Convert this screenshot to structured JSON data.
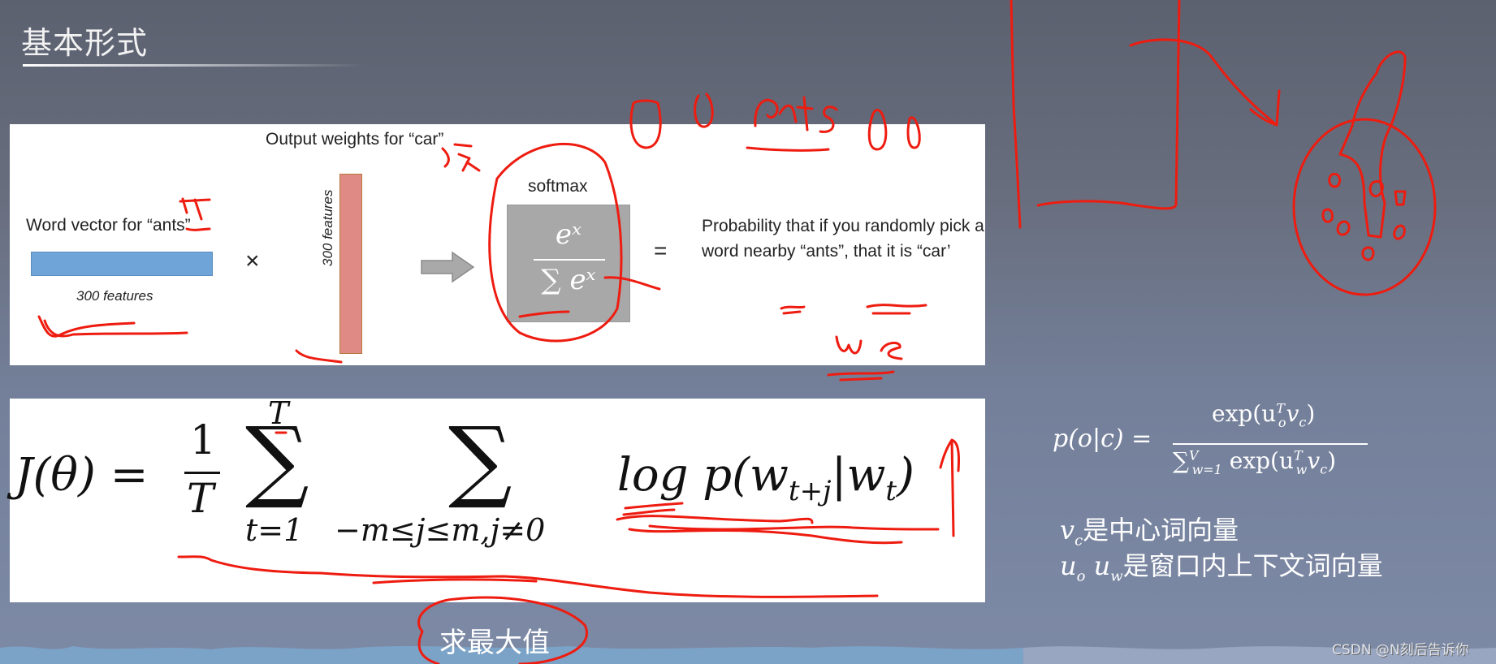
{
  "slide": {
    "title": "基本形式",
    "diagram": {
      "word_vector_label": "Word vector for “ants”",
      "word_vector_features": "300 features",
      "multiply_symbol": "×",
      "output_weights_label": "Output weights for “car”",
      "output_weights_features": "300 features",
      "softmax_label": "softmax",
      "softmax_numerator": "eˣ",
      "softmax_denominator": "∑ eˣ",
      "equals_symbol": "=",
      "probability_text": "Probability that if you randomly pick a word nearby “ants”, that it is “car’"
    },
    "objective": {
      "lhs": "J(θ) =",
      "frac_num": "1",
      "frac_den": "T",
      "sum1_upper": "T",
      "sum1_lower": "t=1",
      "sum2_lower": "−m≤j≤m,j≠0",
      "term": "log p(w",
      "term_sub": "t+j",
      "term_mid": "|w",
      "term_sub2": "t",
      "term_end": ")"
    },
    "softmax_formula": {
      "lhs": "p(o|c) =",
      "numerator": "exp(u",
      "numerator_sup": "T",
      "numerator_sub": "o",
      "numerator_rest": "v",
      "numerator_rest_sub": "c",
      "denominator_sum": "∑",
      "denominator_sum_sup": "V",
      "denominator_sum_sub": "w=1",
      "denominator": "exp(u",
      "denominator_sup": "T",
      "denominator_sub": "w",
      "denominator_rest": "v",
      "denominator_rest_sub": "c"
    },
    "notes": [
      {
        "var": "v",
        "sub": "c",
        "text": "是中心词向量"
      },
      {
        "var": "u",
        "sub": "o",
        "var2": "u",
        "sub2": "w",
        "text": "是窗口内上下文词向量"
      }
    ],
    "goal_label": "求最大值",
    "annotations": {
      "handwritten_ants": "ants",
      "handwritten_we": "we",
      "ink_color": "#ee1c10"
    },
    "watermark": "CSDN @N刻后告诉你"
  }
}
